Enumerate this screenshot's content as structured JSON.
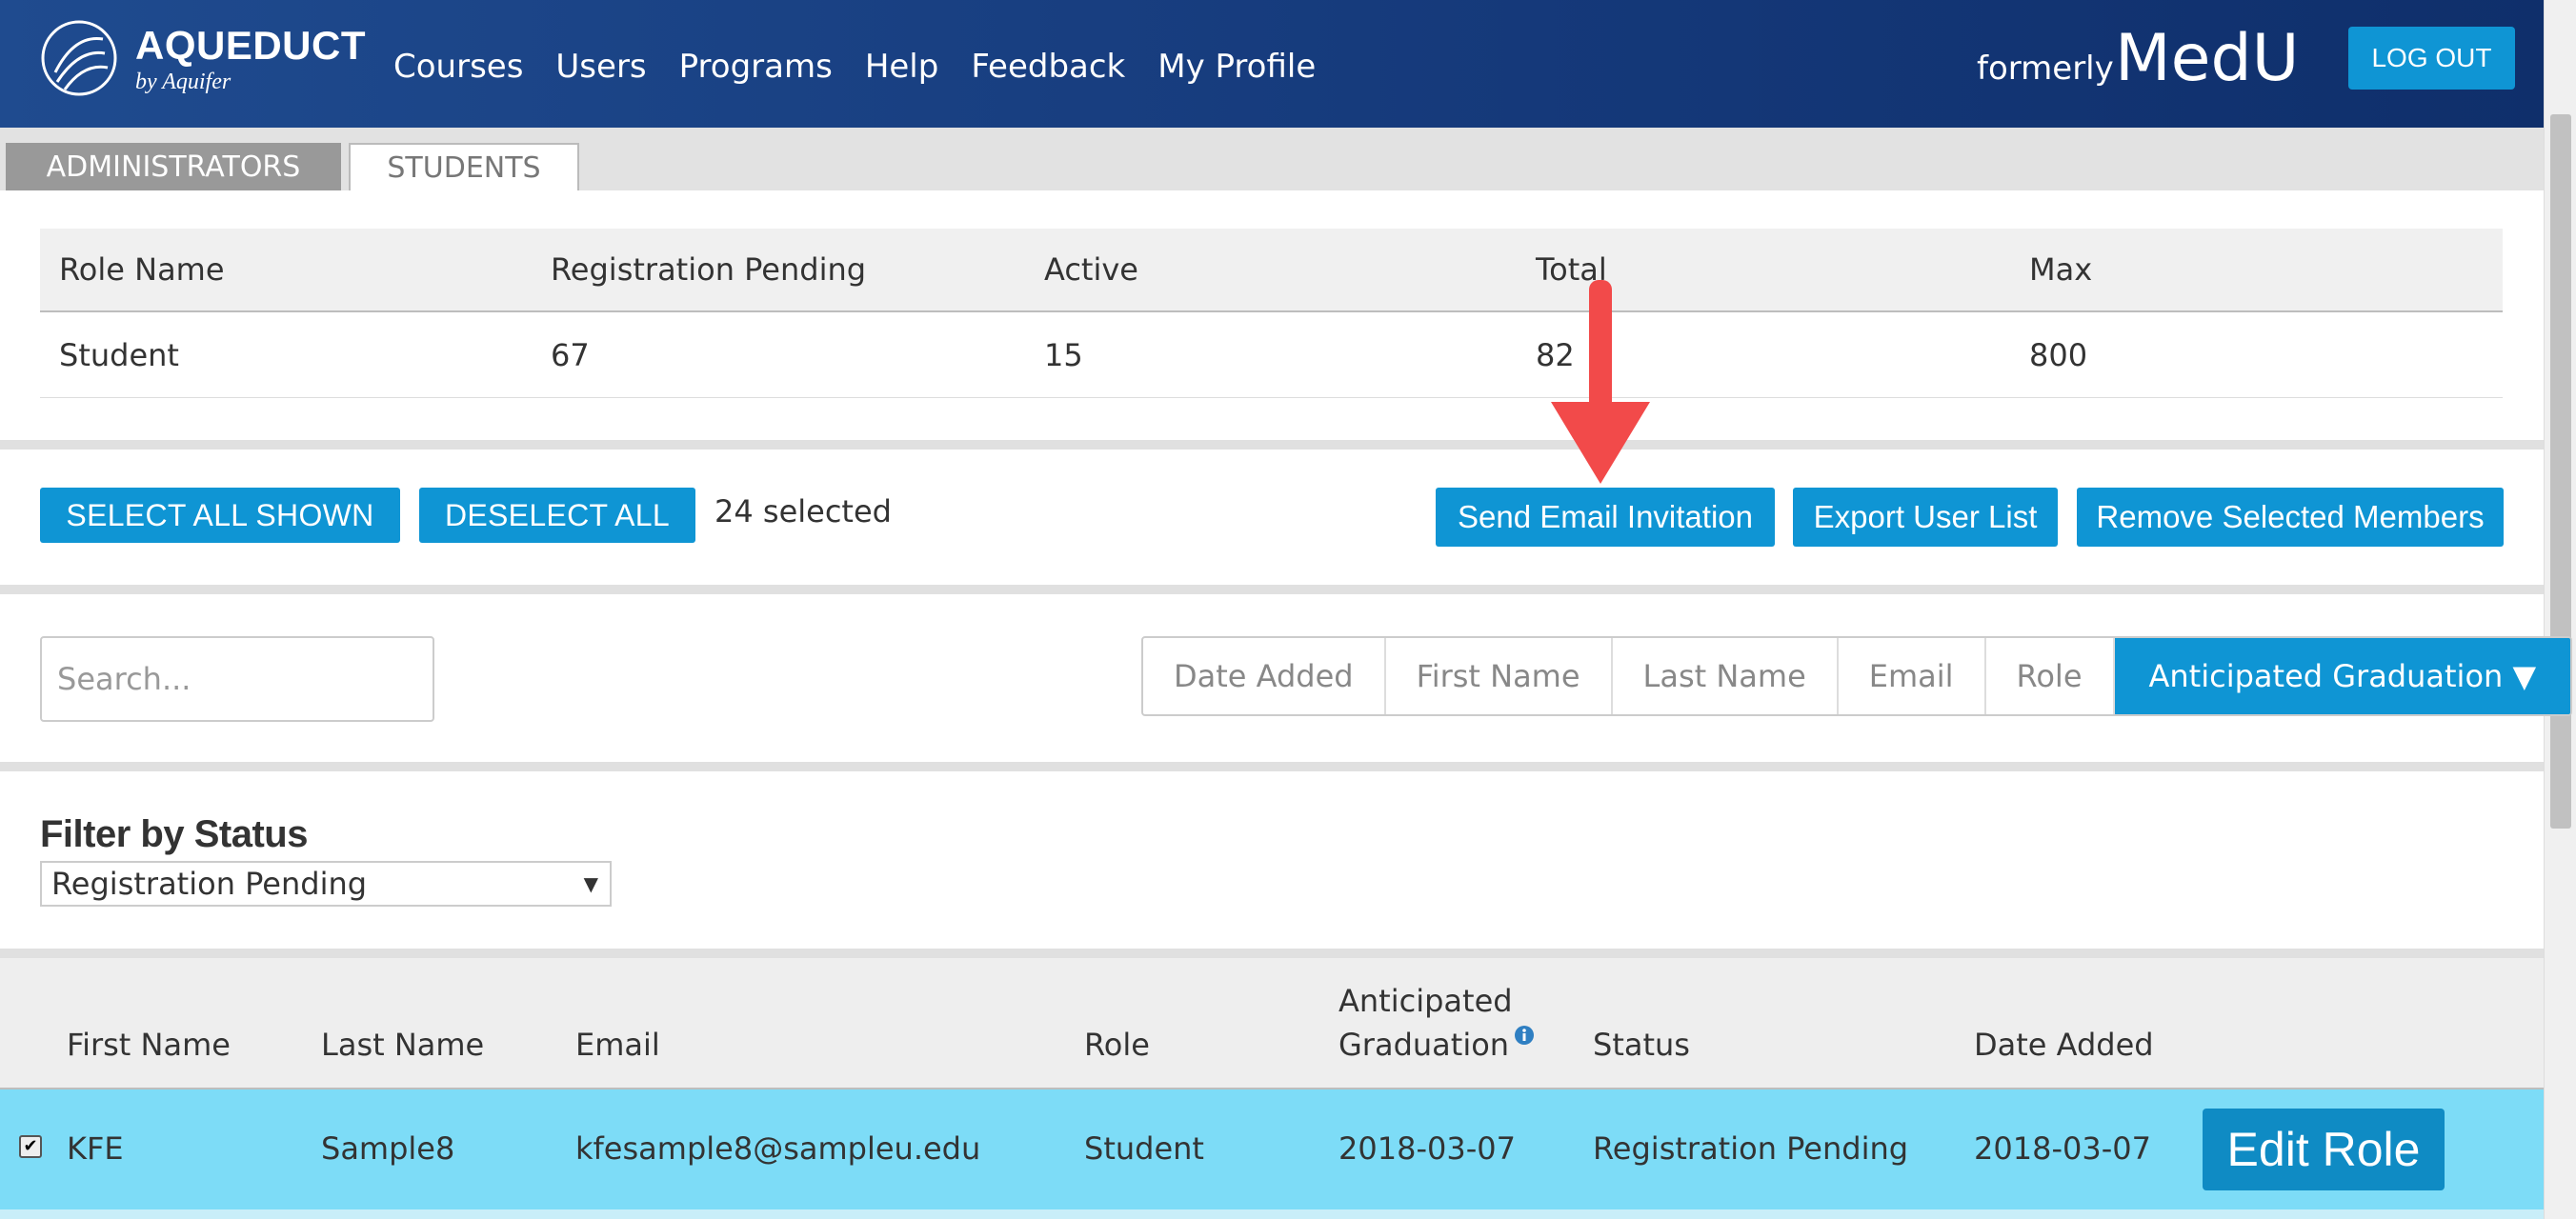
{
  "header": {
    "brand_name": "AQUEDUCT",
    "brand_sub": "by Aquifer",
    "nav": [
      "Courses",
      "Users",
      "Programs",
      "Help",
      "Feedback",
      "My Profile"
    ],
    "formerly": "formerly",
    "medu": "MedU",
    "logout_label": "LOG OUT"
  },
  "tabs": [
    "ADMINISTRATORS",
    "STUDENTS"
  ],
  "summary": {
    "headers": [
      "Role Name",
      "Registration Pending",
      "Active",
      "Total",
      "Max"
    ],
    "row": [
      "Student",
      "67",
      "15",
      "82",
      "800"
    ]
  },
  "actions": {
    "select_all": "SELECT ALL SHOWN",
    "deselect_all": "DESELECT ALL",
    "selected_count": "24 selected",
    "send_invite": "Send Email Invitation",
    "export": "Export User List",
    "remove": "Remove Selected Members"
  },
  "search": {
    "placeholder": "Search..."
  },
  "sort": {
    "options": [
      "Date Added",
      "First Name",
      "Last Name",
      "Email",
      "Role"
    ],
    "active": "Anticipated Graduation ▼"
  },
  "filter": {
    "title": "Filter by Status",
    "selected": "Registration Pending"
  },
  "users_table": {
    "headers": [
      "First Name",
      "Last Name",
      "Email",
      "Role",
      "Anticipated",
      "Graduation",
      "Status",
      "Date Added"
    ],
    "rows": [
      {
        "first": "KFE",
        "last": "Sample8",
        "email": "kfesample8@sampleu.edu",
        "role": "Student",
        "grad": "2018-03-07",
        "status": "Registration Pending",
        "date_added": "2018-03-07",
        "checked": true,
        "action": "Edit Role"
      }
    ]
  },
  "colors": {
    "header_bg": "#1f4b8f",
    "accent": "#0f95d4",
    "selected_row": "#7ddcf7",
    "arrow": "#f24a4a"
  }
}
